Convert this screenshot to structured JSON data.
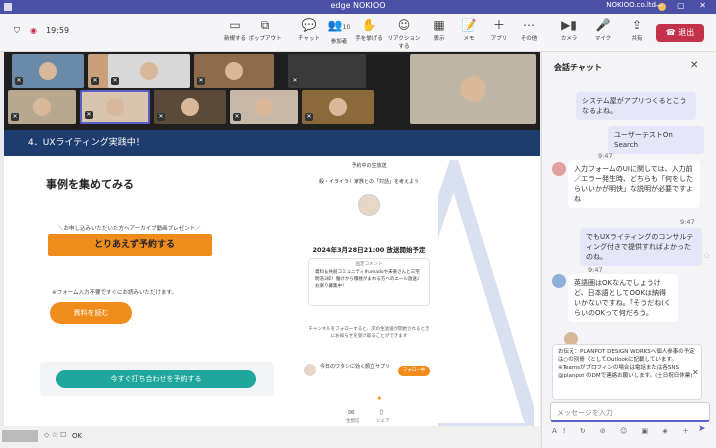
{
  "window": {
    "title": "edge NOKIOO",
    "org": "NOKIOO.co.ltd"
  },
  "call": {
    "timer": "19:59"
  },
  "toolbar": {
    "items": [
      {
        "label": "新規する"
      },
      {
        "label": "ポップアウト"
      },
      {
        "label": "チャット"
      },
      {
        "label": "参加者",
        "count": "10"
      },
      {
        "label": "手を挙げる"
      },
      {
        "label": "リアクションする"
      },
      {
        "label": "表示"
      },
      {
        "label": "メモ"
      },
      {
        "label": "アプリ"
      },
      {
        "label": "その他"
      },
      {
        "label": "カメラ"
      },
      {
        "label": "マイク"
      },
      {
        "label": "共有"
      }
    ],
    "leave_label": "退出"
  },
  "slide": {
    "banner": "4．UXライティング実践中！",
    "heading": "事例を集めてみる",
    "promo_label": "＼お申し込みいただいた方へアーカイブ動画プレゼント／",
    "cta_primary": "とりあえず予約する",
    "form_note": "※フォーム入力不要ですぐにお読みいただけます。",
    "cta_read": "資料を読む",
    "cta_contact": "今すぐ打ち合わせを予約する",
    "phone": {
      "header": "予約中の生放送",
      "subtitle": "殺・イライラ！家族との「対話」を考えよう",
      "datetime": "2024年3月28日21:00 放送開始予定",
      "comment_title": "固定コメント",
      "comment_body": "資料＆共創コミュニティ#umadoや未来さんと三宅明浩3枠！働けから積極がまわる方へのエール放送♪ お楽り募集中！",
      "follow_note": "チャンネルをフォローすると、次の生放送が開始されるときにお知らせを受け取ることができます",
      "host_name": "今日のワタシに効く顔立サプリ",
      "follow_btn": "フォロー中",
      "nav_1": "生配信",
      "nav_2": "シェア"
    }
  },
  "chat": {
    "title": "会話チャット",
    "messages": [
      {
        "text": "システム屋がアプリつくるとこうなるよね。",
        "side": "me"
      },
      {
        "text": "ユーザーテストOn Search",
        "side": "me"
      },
      {
        "time": "9:47",
        "text": "入力フォームのUIに関しては、入力前／エラー発生時、どちらも「何をしたらいいかが明快」な説明が必要ですよね",
        "side": "other"
      },
      {
        "time": "9:47",
        "text": "でもUXライティングのコンサルティング付きで提供すればよかったのね。",
        "side": "me"
      },
      {
        "time": "9:47",
        "text": "英語圏はOKなんでしょうけど、日本語としてOOKは納得いかないですね。「そうだね(くらいのOKって何だろう。",
        "side": "other"
      }
    ],
    "notice": "お伝え：PLANPOT DESIGN WORKSへ個人参事の予定は○の別冊（としてOutlookに記載しています。※Teamsがプロフィンの場合は電話または各SNS @planpot のDMで連絡お願いします。(土日祝日休業)",
    "input_placeholder": "メッセージを入力"
  },
  "statusbar": {
    "text": "OK"
  }
}
